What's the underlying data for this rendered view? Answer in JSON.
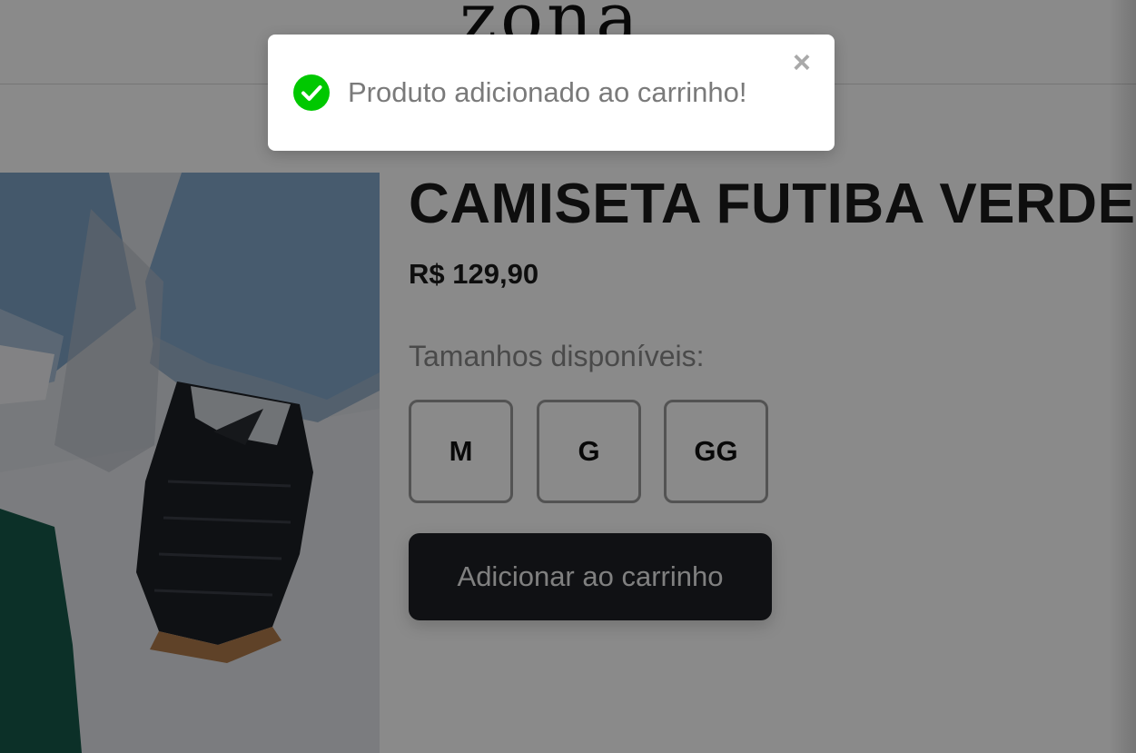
{
  "header": {
    "logo_text": "zona"
  },
  "product": {
    "title": "CAMISETA FUTIBA VERDE",
    "price": "R$ 129,90",
    "sizes_label": "Tamanhos disponíveis:",
    "sizes": [
      "M",
      "G",
      "GG"
    ],
    "add_to_cart_label": "Adicionar ao carrinho",
    "image_icon": "product-photo"
  },
  "toast": {
    "message": "Produto adicionado ao carrinho!",
    "close_symbol": "×",
    "status_icon": "check-circle-icon",
    "status_color": "#00c800"
  },
  "colors": {
    "button_bg": "#1f2125",
    "overlay": "rgba(0,0,0,0.46)"
  }
}
